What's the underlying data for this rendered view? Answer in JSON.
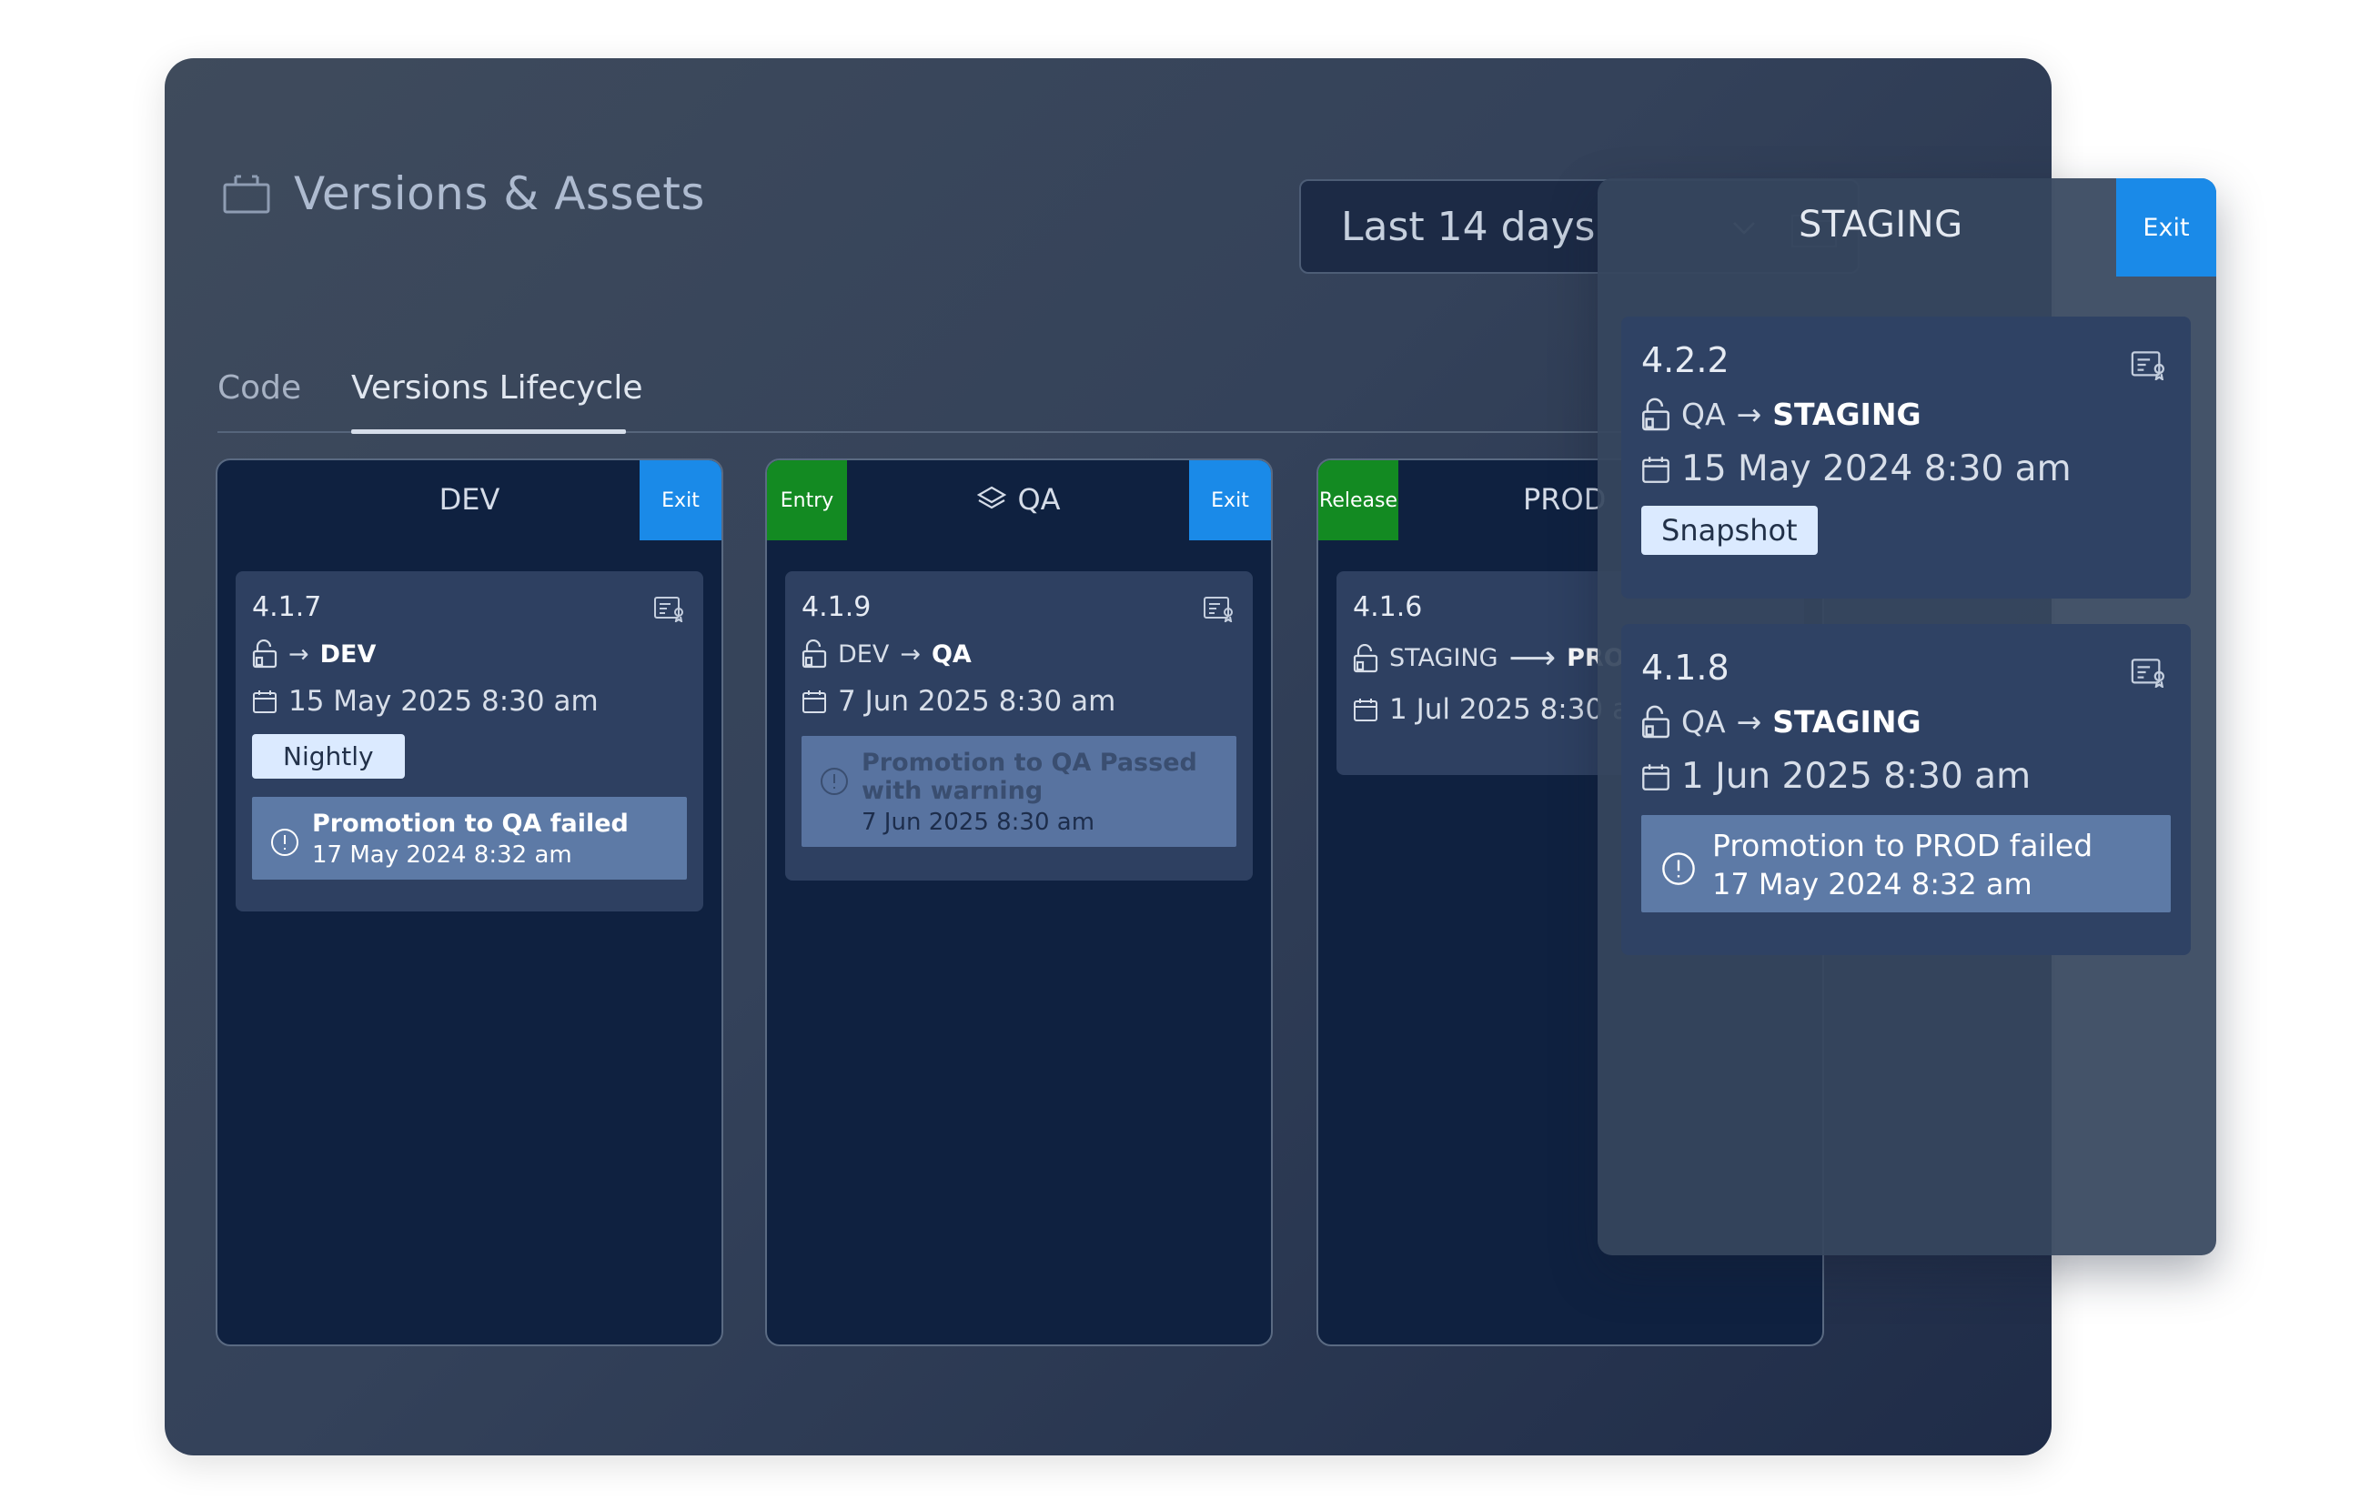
{
  "app": {
    "title": "Versions & Assets",
    "icon": "briefcase-icon"
  },
  "range_select": {
    "value": "Last 14 days"
  },
  "tabs": [
    {
      "label": "Code"
    },
    {
      "label": "Versions Lifecycle",
      "active": true
    }
  ],
  "stages": {
    "dev": {
      "title": "DEV",
      "exit_label": "Exit",
      "card": {
        "version": "4.1.7",
        "to": "DEV",
        "date": "15 May 2025 8:30 am",
        "chip": "Nightly",
        "notice": {
          "title": "Promotion to QA failed",
          "date": "17 May 2024 8:32 am"
        }
      }
    },
    "qa": {
      "title": "QA",
      "entry_label": "Entry",
      "exit_label": "Exit",
      "card": {
        "version": "4.1.9",
        "from": "DEV",
        "to": "QA",
        "date": "7 Jun 2025 8:30 am",
        "notice": {
          "title": "Promotion to QA Passed with warning",
          "date": "7 Jun 2025 8:30 am"
        }
      }
    },
    "prod": {
      "title": "PROD",
      "release_label": "Release",
      "card": {
        "version": "4.1.6",
        "from": "STAGING",
        "to": "PROD",
        "date": "1 Jul 2025 8:30 am"
      }
    }
  },
  "staging": {
    "title": "STAGING",
    "exit_label": "Exit",
    "cards": [
      {
        "version": "4.2.2",
        "from": "QA",
        "to": "STAGING",
        "date": "15 May 2024 8:30 am",
        "chip": "Snapshot"
      },
      {
        "version": "4.1.8",
        "from": "QA",
        "to": "STAGING",
        "date": "1 Jun 2025 8:30 am",
        "notice": {
          "title": "Promotion to PROD failed",
          "date": "17 May 2024 8:32 am"
        }
      }
    ]
  },
  "colors": {
    "exit": "#1a8ae8",
    "entry": "#138a22",
    "stage_bg": "#0f2140",
    "card_bg": "#2e4061",
    "notice_bg": "#5d7aa6"
  }
}
